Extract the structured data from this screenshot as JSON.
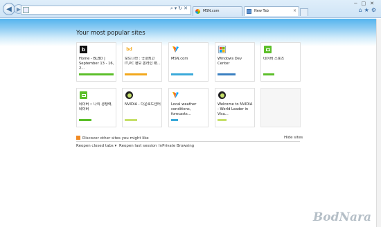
{
  "browser": {
    "address_value": "",
    "tabs": [
      {
        "label": "MSN.com"
      },
      {
        "label": "New Tab"
      }
    ],
    "tab_close": "×"
  },
  "content": {
    "title": "Your most popular sites",
    "tiles": [
      {
        "text": "Home - BLBD | September 13 - 16, 2...",
        "logo": "b",
        "bar_color": "#5cbf2a",
        "bar_fill": 1.0
      },
      {
        "text": "보드나라 : 국내최고 IT,PC 정보 온라인 매...",
        "logo": "bd",
        "bar_color": "#f2a81c",
        "bar_fill": 0.6
      },
      {
        "text": "MSN.com",
        "logo": "msn",
        "bar_color": "#3aa9d9",
        "bar_fill": 0.6
      },
      {
        "text": "Windows Dev Center",
        "logo": "win",
        "bar_color": "#3a7fc1",
        "bar_fill": 0.5
      },
      {
        "text": "네이버 스포츠",
        "logo": "nv",
        "bar_color": "#5cbf2a",
        "bar_fill": 0.3
      },
      {
        "text": "네이버 :: 나의 경쟁력, 네이버",
        "logo": "nv",
        "bar_color": "#5cbf2a",
        "bar_fill": 0.35
      },
      {
        "text": "NVIDIA - 다운로드센터",
        "logo": "nvidia",
        "bar_color": "#c6e06a",
        "bar_fill": 0.35
      },
      {
        "text": "Local weather conditions, forecasts...",
        "logo": "msn",
        "bar_color": "#3aa9d9",
        "bar_fill": 0.2
      },
      {
        "text": "Welcome to NVIDIA - World Leader in Visu...",
        "logo": "nvidia",
        "bar_color": "#c6e06a",
        "bar_fill": 0.25
      },
      {
        "text": "",
        "logo": "",
        "bar_color": "",
        "bar_fill": 0
      }
    ],
    "discover_label": "Discover other sites you might like",
    "hide_sites_label": "Hide sites",
    "reopen_closed_tabs_label": "Reopen closed tabs ▾",
    "reopen_last_session_label": "Reopen last session",
    "inprivate_label": "InPrivate Browsing"
  },
  "watermark": "BodNara"
}
